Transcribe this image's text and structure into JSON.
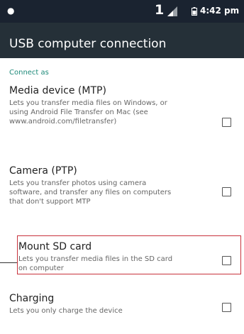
{
  "status_bar": {
    "notification_icon": "notification-dot-icon",
    "sim_indicator": "1",
    "signal_icon": "signal-icon",
    "battery_icon": "battery-icon",
    "time": "4:42 pm"
  },
  "app_bar": {
    "title": "USB computer connection"
  },
  "section": {
    "header": "Connect as"
  },
  "options": [
    {
      "title": "Media device (MTP)",
      "summary_lines": [
        "Lets you transfer media files on Windows, or",
        "using Android File Transfer on Mac (see",
        "www.android.com/filetransfer)"
      ],
      "checked": false
    },
    {
      "title": "Camera (PTP)",
      "summary_lines": [
        "Lets you transfer photos using camera",
        "software, and transfer any files on computers",
        "that don't support MTP"
      ],
      "checked": false
    },
    {
      "title": "Mount SD card",
      "summary_lines": [
        "Lets you transfer media files in the SD card",
        "on computer"
      ],
      "checked": false
    },
    {
      "title": "Charging",
      "summary_lines": [
        "Lets you only charge the device"
      ],
      "checked": false
    }
  ],
  "colors": {
    "status_bar_bg": "#1a2330",
    "app_bar_bg": "#253038",
    "section_accent": "#1f8a7a",
    "highlight": "#c8323c"
  }
}
